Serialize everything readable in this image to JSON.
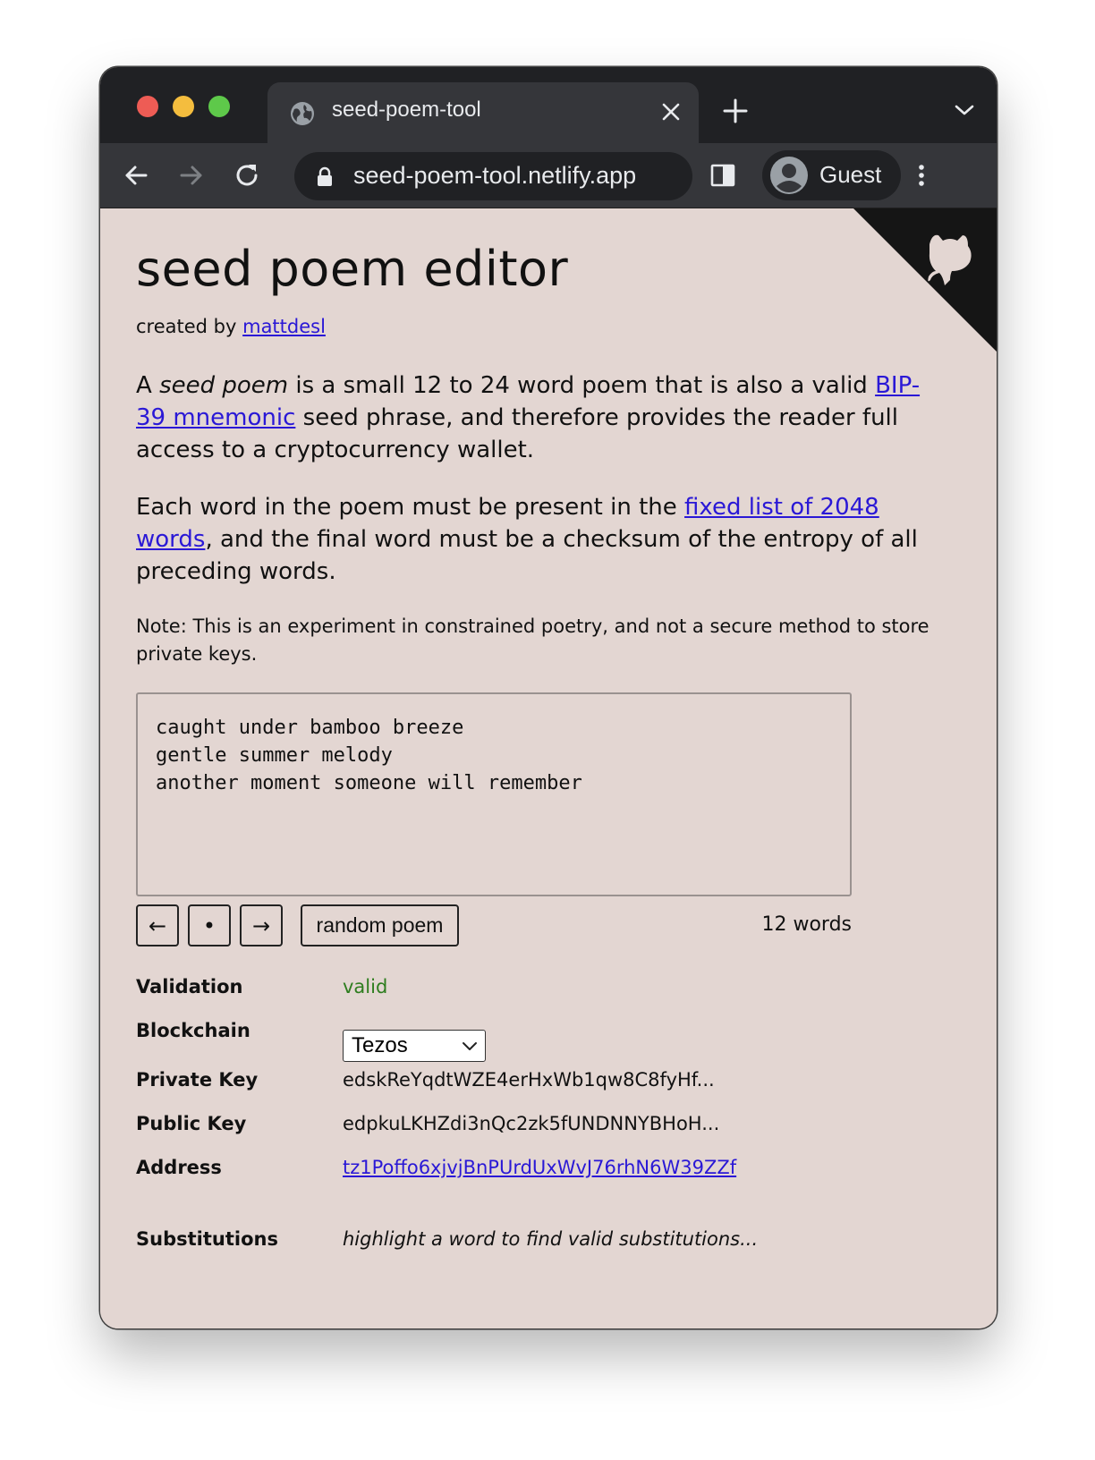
{
  "browser": {
    "tab_title": "seed-poem-tool",
    "url": "seed-poem-tool.netlify.app",
    "profile_label": "Guest"
  },
  "page": {
    "title": "seed poem editor",
    "credit_prefix": "created by ",
    "credit_link": "mattdesl",
    "intro": {
      "a": "A ",
      "seed_poem": "seed poem",
      "middle": " is a small 12 to 24 word poem that is also a valid ",
      "bip_link": "BIP-39 mnemonic",
      "end": " seed phrase, and therefore provides the reader full access to a cryptocurrency wallet."
    },
    "words_para": {
      "start": "Each word in the poem must be present in the ",
      "link": "fixed list of 2048 words",
      "end": ", and the final word must be a checksum of the entropy of all preceding words."
    },
    "note": "Note: This is an experiment in constrained poetry, and not a secure method to store private keys.",
    "poem_lines": [
      "caught under bamboo breeze",
      "gentle summer melody",
      "another moment someone will remember"
    ],
    "controls": {
      "prev": "←",
      "dot": "•",
      "next": "→",
      "random": "random poem"
    },
    "word_count": "12 words",
    "details": {
      "validation_label": "Validation",
      "validation_value": "valid",
      "blockchain_label": "Blockchain",
      "blockchain_value": "Tezos",
      "private_key_label": "Private Key",
      "private_key_value": "edskReYqdtWZE4erHxWb1qw8C8fyHf...",
      "public_key_label": "Public Key",
      "public_key_value": "edpkuLKHZdi3nQc2zk5fUNDNNYBHoH...",
      "address_label": "Address",
      "address_value": "tz1Poffo6xjvjBnPUrdUxWvJ76rhN6W39ZZf",
      "substitutions_label": "Substitutions",
      "substitutions_value": "highlight a word to find valid substitutions..."
    }
  },
  "colors": {
    "page_background": "#e3d6d2",
    "link": "#2a18d6",
    "valid": "#2e7d1f",
    "chrome_dark": "#202124",
    "chrome_toolbar": "#35363a"
  },
  "icons": [
    "globe-icon",
    "close-icon",
    "plus-icon",
    "chevron-down-icon",
    "back-arrow-icon",
    "forward-arrow-icon",
    "reload-icon",
    "lock-icon",
    "sidebar-icon",
    "avatar-icon",
    "kebab-menu-icon",
    "github-octocat-icon"
  ]
}
